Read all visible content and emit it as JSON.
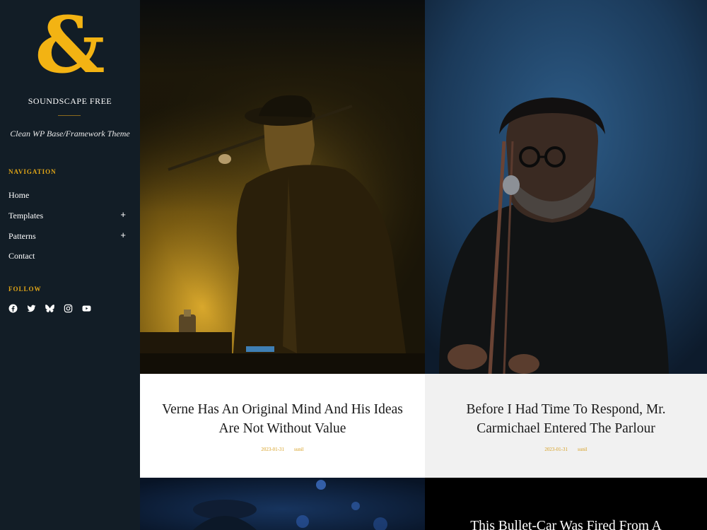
{
  "site": {
    "logo_glyph": "&",
    "title": "SOUNDSCAPE FREE",
    "tagline": "Clean WP Base/Framework Theme",
    "accent_color": "#f3b313"
  },
  "sidebar": {
    "navigation_heading": "NAVIGATION",
    "nav_items": [
      {
        "label": "Home",
        "has_submenu": false
      },
      {
        "label": "Templates",
        "has_submenu": true,
        "toggle": "+"
      },
      {
        "label": "Patterns",
        "has_submenu": true,
        "toggle": "+"
      },
      {
        "label": "Contact",
        "has_submenu": false
      }
    ],
    "follow_heading": "FOLLOW",
    "social_icons": [
      "facebook-icon",
      "twitter-icon",
      "bluesky-icon",
      "instagram-icon",
      "youtube-icon"
    ]
  },
  "posts": [
    {
      "title": "Verne Has An Original Mind And His Ideas Are Not Without Value",
      "date": "2023-01-31",
      "author": "sunil",
      "image": "guitarist performing in yellow stage light"
    },
    {
      "title": "Before I Had Time To Respond, Mr. Carmichael Entered The Parlour",
      "date": "2023-01-31",
      "author": "sunil",
      "image": "singer with glasses at microphone in blue light"
    },
    {
      "title": "This Bullet-Car Was Fired From A",
      "image": "dark background"
    }
  ]
}
